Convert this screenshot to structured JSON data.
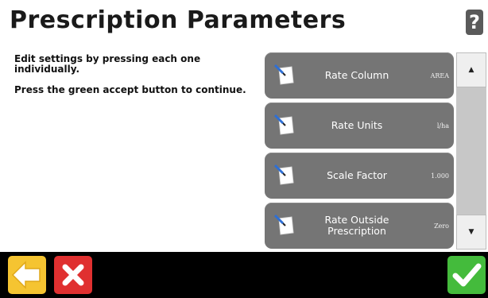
{
  "header": {
    "title": "Prescription Parameters",
    "help_label": "?"
  },
  "instructions": {
    "line1": "Edit settings by pressing each one individually.",
    "line2": "Press the green accept button to continue."
  },
  "settings": [
    {
      "label": "Rate Column",
      "value": "AREA"
    },
    {
      "label": "Rate Units",
      "value": "l/ha"
    },
    {
      "label": "Scale Factor",
      "value": "1.000"
    },
    {
      "label": "Rate Outside Prescription",
      "value": "Zero"
    }
  ],
  "scrollbar": {
    "up_glyph": "▲",
    "down_glyph": "▼"
  },
  "colors": {
    "back": "#f5c431",
    "cancel": "#e03030",
    "accept": "#44bb3c",
    "item": "#757575"
  },
  "icons": {
    "setting": "edit-note-icon",
    "back": "arrow-left-icon",
    "cancel": "close-x-icon",
    "accept": "checkmark-icon",
    "help": "question-icon"
  }
}
